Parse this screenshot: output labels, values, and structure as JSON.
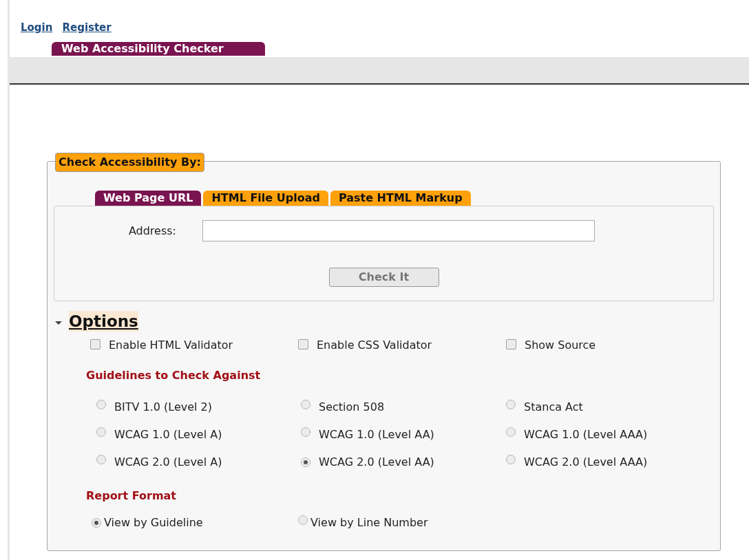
{
  "top_links": [
    "Login",
    "Register"
  ],
  "site_tab": "Web Accessibility Checker",
  "legend": "Check Accessibility By:",
  "tabs": [
    {
      "label": "Web Page URL",
      "selected": true
    },
    {
      "label": "HTML File Upload",
      "selected": false
    },
    {
      "label": "Paste HTML Markup",
      "selected": false
    }
  ],
  "address": {
    "label": "Address:"
  },
  "check_button": {
    "label": "Check It",
    "disabled": true
  },
  "options": {
    "title": "Options",
    "expanded": true,
    "checkboxes": [
      {
        "label": "Enable HTML Validator",
        "checked": false
      },
      {
        "label": "Enable CSS Validator",
        "checked": false
      },
      {
        "label": "Show Source",
        "checked": false
      }
    ],
    "guidelines_heading": "Guidelines to Check Against",
    "guidelines": [
      {
        "label": "BITV 1.0 (Level 2)",
        "selected": false
      },
      {
        "label": "Section 508",
        "selected": false
      },
      {
        "label": "Stanca Act",
        "selected": false
      },
      {
        "label": "WCAG 1.0 (Level A)",
        "selected": false
      },
      {
        "label": "WCAG 1.0 (Level AA)",
        "selected": false
      },
      {
        "label": "WCAG 1.0 (Level AAA)",
        "selected": false
      },
      {
        "label": "WCAG 2.0 (Level A)",
        "selected": false
      },
      {
        "label": "WCAG 2.0 (Level AA)",
        "selected": true
      },
      {
        "label": "WCAG 2.0 (Level AAA)",
        "selected": false
      }
    ],
    "report_heading": "Report Format",
    "report_formats": [
      {
        "label": "View by Guideline",
        "selected": true
      },
      {
        "label": "View by Line Number",
        "selected": false
      }
    ]
  }
}
